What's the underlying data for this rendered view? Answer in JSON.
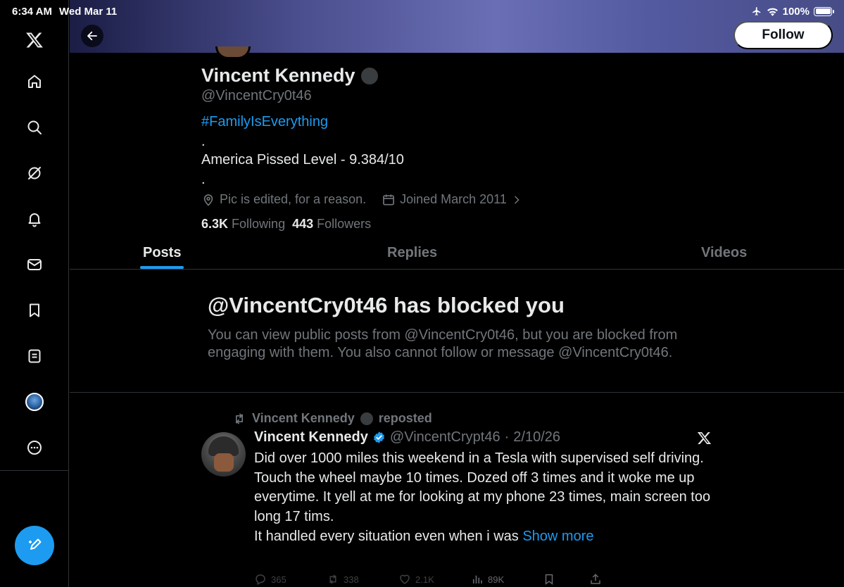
{
  "status_bar": {
    "time": "6:34 AM",
    "date": "Wed Mar 11",
    "battery": "100%"
  },
  "sidebar": {
    "items": [
      {
        "icon": "x-logo-icon"
      },
      {
        "icon": "home-icon"
      },
      {
        "icon": "search-icon"
      },
      {
        "icon": "grok-icon"
      },
      {
        "icon": "notifications-icon"
      },
      {
        "icon": "messages-icon"
      },
      {
        "icon": "bookmarks-icon"
      },
      {
        "icon": "lists-icon"
      },
      {
        "icon": "profile-avatar-icon"
      },
      {
        "icon": "more-icon"
      }
    ],
    "compose_icon": "compose-icon"
  },
  "header": {
    "follow_label": "Follow"
  },
  "profile": {
    "name": "Vincent Kennedy",
    "handle": "@VincentCry0t46",
    "hashtag": "#FamilyIsEverything",
    "bio_dot_1": ".",
    "bio_line": "America Pissed Level - 9.384/10",
    "bio_dot_2": ".",
    "location": "Pic is edited, for a reason.",
    "joined": "Joined March 2011",
    "following_count": "6.3K",
    "following_label": "Following",
    "followers_count": "443",
    "followers_label": "Followers"
  },
  "tabs": [
    {
      "label": "Posts",
      "active": true
    },
    {
      "label": "Replies",
      "active": false
    },
    {
      "label": "Videos",
      "active": false
    }
  ],
  "blocked": {
    "title": "@VincentCry0t46 has blocked you",
    "description": "You can view public posts from @VincentCry0t46, but you are blocked from engaging with them. You also cannot follow or message @VincentCry0t46."
  },
  "post": {
    "repost_by": "Vincent Kennedy",
    "repost_label": "reposted",
    "author_name": "Vincent Kennedy",
    "author_handle": "@VincentCrypt46",
    "separator": "·",
    "date": "2/10/26",
    "lines": [
      "Did over 1000 miles this weekend in a Tesla with supervised self driving.",
      "Touch the wheel maybe 10 times. Dozed off 3 times and it woke me up everytime. It yell at me for looking at my phone 23 times, main screen too long 17 tims.",
      "It handled every situation even when i was"
    ],
    "show_more": "Show more",
    "replies": "365",
    "reposts": "338",
    "likes": "2.1K",
    "views": "89K"
  },
  "colors": {
    "accent": "#1d9bf0",
    "text": "#e7e9ea",
    "muted": "#71767b",
    "border": "#2f3336",
    "background": "#000000"
  }
}
